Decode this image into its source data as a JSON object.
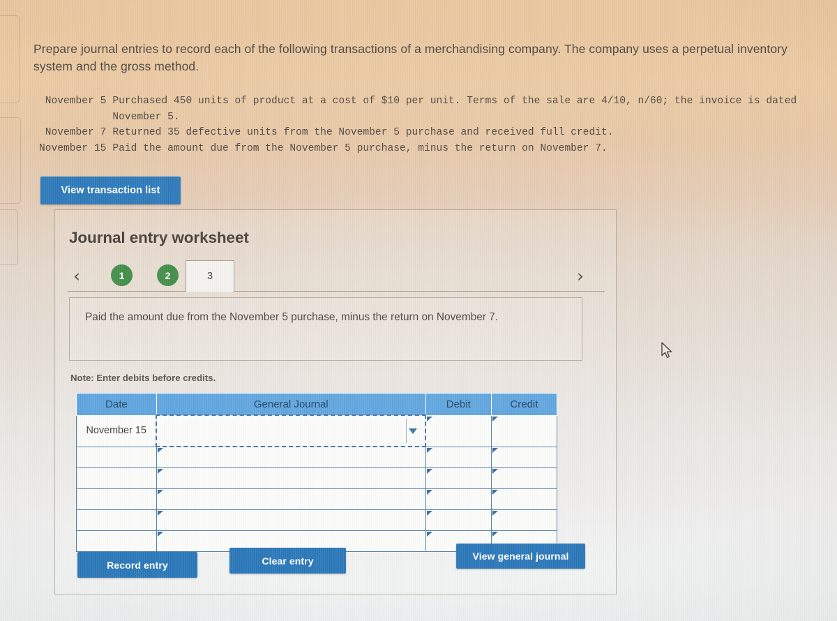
{
  "prompt": {
    "text": "Prepare journal entries to record each of the following transactions of a merchandising company. The company uses a perpetual inventory system and the gross method."
  },
  "transactions": [
    {
      "date": "November 5",
      "description": "Purchased 450 units of product at a cost of $10 per unit. Terms of the sale are 4/10, n/60; the invoice is dated November 5."
    },
    {
      "date": "November 7",
      "description": "Returned 35 defective units from the November 5 purchase and received full credit."
    },
    {
      "date": "November 15",
      "description": "Paid the amount due from the November 5 purchase, minus the return on November 7."
    }
  ],
  "buttons": {
    "view_transaction_list": "View transaction list",
    "record_entry": "Record entry",
    "clear_entry": "Clear entry",
    "view_general_journal": "View general journal"
  },
  "worksheet": {
    "title": "Journal entry worksheet",
    "prev_icon": "‹",
    "next_icon": "›",
    "steps": [
      {
        "label": "1",
        "state": "completed"
      },
      {
        "label": "2",
        "state": "completed"
      },
      {
        "label": "3",
        "state": "active"
      }
    ],
    "instruction": "Paid the amount due from the November 5 purchase, minus the return on November 7.",
    "note": "Note: Enter debits before credits.",
    "table": {
      "headers": [
        "Date",
        "General Journal",
        "Debit",
        "Credit"
      ],
      "rows": [
        {
          "date": "November 15",
          "journal": "",
          "debit": "",
          "credit": ""
        },
        {
          "date": "",
          "journal": "",
          "debit": "",
          "credit": ""
        },
        {
          "date": "",
          "journal": "",
          "debit": "",
          "credit": ""
        },
        {
          "date": "",
          "journal": "",
          "debit": "",
          "credit": ""
        },
        {
          "date": "",
          "journal": "",
          "debit": "",
          "credit": ""
        },
        {
          "date": "",
          "journal": "",
          "debit": "",
          "credit": ""
        }
      ]
    }
  },
  "colors": {
    "button_blue": "#2876b8",
    "header_blue": "#5ba3dd",
    "step_green": "#3d8b43",
    "grid_line": "#4e7ea6"
  }
}
